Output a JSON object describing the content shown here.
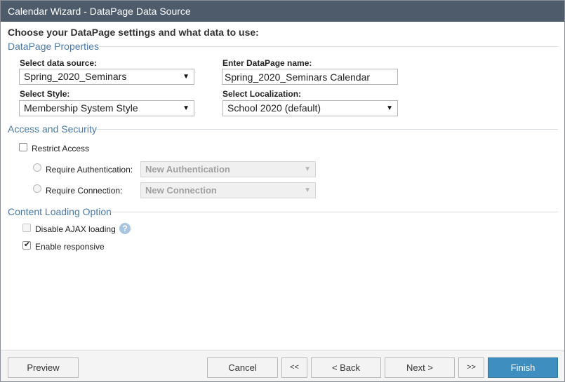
{
  "window": {
    "title": "Calendar Wizard - DataPage Data Source"
  },
  "heading": "Choose your DataPage settings and what data to use:",
  "properties": {
    "section_title": "DataPage Properties",
    "data_source_label": "Select data source:",
    "data_source_value": "Spring_2020_Seminars",
    "name_label": "Enter DataPage name:",
    "name_value": "Spring_2020_Seminars Calendar",
    "style_label": "Select Style:",
    "style_value": "Membership System Style",
    "localization_label": "Select Localization:",
    "localization_value": "School 2020 (default)"
  },
  "security": {
    "section_title": "Access and Security",
    "restrict_label": "Restrict Access",
    "auth_label": "Require Authentication:",
    "auth_value": "New Authentication",
    "conn_label": "Require Connection:",
    "conn_value": "New Connection"
  },
  "loading": {
    "section_title": "Content Loading Option",
    "ajax_label": "Disable AJAX loading",
    "help_glyph": "?",
    "responsive_label": "Enable responsive",
    "responsive_checked": true
  },
  "footer": {
    "preview": "Preview",
    "cancel": "Cancel",
    "first": "<<",
    "back": "< Back",
    "next": "Next >",
    "last": ">>",
    "finish": "Finish"
  },
  "icons": {
    "dropdown_arrow": "▼",
    "check": "✔"
  },
  "colors": {
    "titlebar": "#4d5b6b",
    "section": "#4a79a8",
    "primary": "#3e8fc0"
  }
}
